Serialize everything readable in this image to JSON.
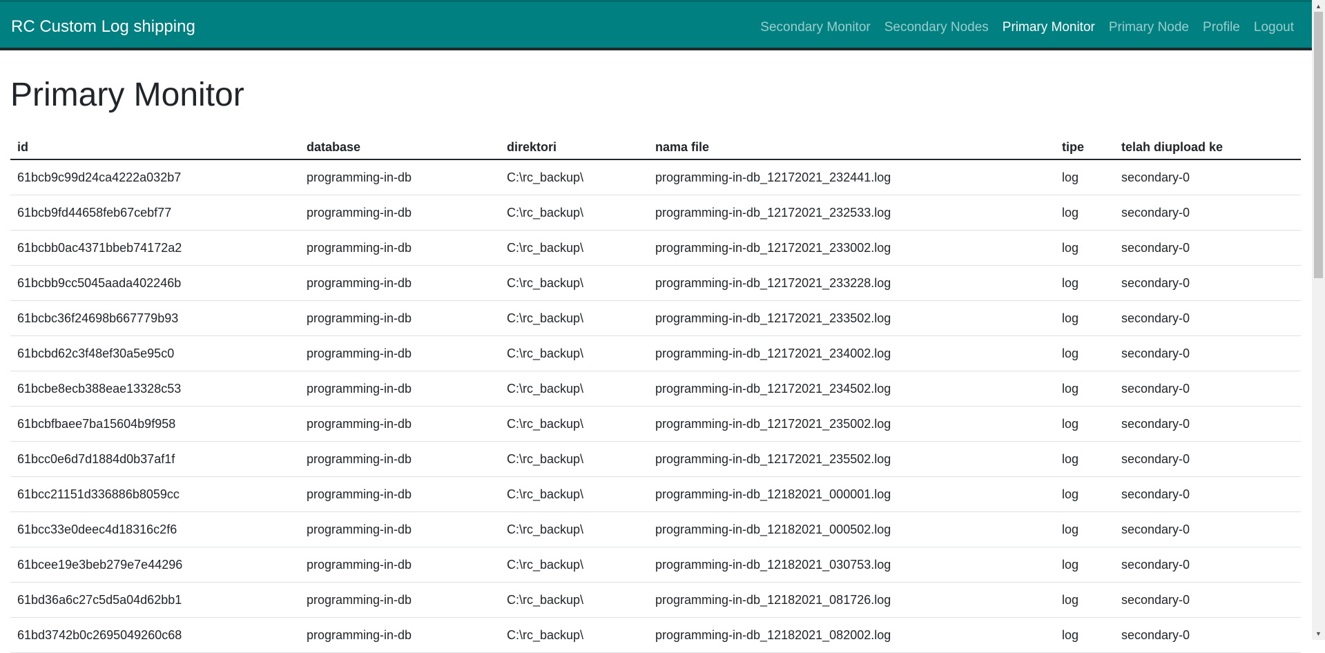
{
  "app": {
    "brand": "RC Custom Log shipping",
    "nav": [
      {
        "label": "Secondary Monitor",
        "active": false
      },
      {
        "label": "Secondary Nodes",
        "active": false
      },
      {
        "label": "Primary Monitor",
        "active": true
      },
      {
        "label": "Primary Node",
        "active": false
      },
      {
        "label": "Profile",
        "active": false
      },
      {
        "label": "Logout",
        "active": false
      }
    ]
  },
  "page": {
    "title": "Primary Monitor"
  },
  "table": {
    "headers": [
      "id",
      "database",
      "direktori",
      "nama file",
      "tipe",
      "telah diupload ke"
    ],
    "rows": [
      [
        "61bcb9c99d24ca4222a032b7",
        "programming-in-db",
        "C:\\rc_backup\\",
        "programming-in-db_12172021_232441.log",
        "log",
        "secondary-0"
      ],
      [
        "61bcb9fd44658feb67cebf77",
        "programming-in-db",
        "C:\\rc_backup\\",
        "programming-in-db_12172021_232533.log",
        "log",
        "secondary-0"
      ],
      [
        "61bcbb0ac4371bbeb74172a2",
        "programming-in-db",
        "C:\\rc_backup\\",
        "programming-in-db_12172021_233002.log",
        "log",
        "secondary-0"
      ],
      [
        "61bcbb9cc5045aada402246b",
        "programming-in-db",
        "C:\\rc_backup\\",
        "programming-in-db_12172021_233228.log",
        "log",
        "secondary-0"
      ],
      [
        "61bcbc36f24698b667779b93",
        "programming-in-db",
        "C:\\rc_backup\\",
        "programming-in-db_12172021_233502.log",
        "log",
        "secondary-0"
      ],
      [
        "61bcbd62c3f48ef30a5e95c0",
        "programming-in-db",
        "C:\\rc_backup\\",
        "programming-in-db_12172021_234002.log",
        "log",
        "secondary-0"
      ],
      [
        "61bcbe8ecb388eae13328c53",
        "programming-in-db",
        "C:\\rc_backup\\",
        "programming-in-db_12172021_234502.log",
        "log",
        "secondary-0"
      ],
      [
        "61bcbfbaee7ba15604b9f958",
        "programming-in-db",
        "C:\\rc_backup\\",
        "programming-in-db_12172021_235002.log",
        "log",
        "secondary-0"
      ],
      [
        "61bcc0e6d7d1884d0b37af1f",
        "programming-in-db",
        "C:\\rc_backup\\",
        "programming-in-db_12172021_235502.log",
        "log",
        "secondary-0"
      ],
      [
        "61bcc21151d336886b8059cc",
        "programming-in-db",
        "C:\\rc_backup\\",
        "programming-in-db_12182021_000001.log",
        "log",
        "secondary-0"
      ],
      [
        "61bcc33e0deec4d18316c2f6",
        "programming-in-db",
        "C:\\rc_backup\\",
        "programming-in-db_12182021_000502.log",
        "log",
        "secondary-0"
      ],
      [
        "61bcee19e3beb279e7e44296",
        "programming-in-db",
        "C:\\rc_backup\\",
        "programming-in-db_12182021_030753.log",
        "log",
        "secondary-0"
      ],
      [
        "61bd36a6c27c5d5a04d62bb1",
        "programming-in-db",
        "C:\\rc_backup\\",
        "programming-in-db_12182021_081726.log",
        "log",
        "secondary-0"
      ],
      [
        "61bd3742b0c2695049260c68",
        "programming-in-db",
        "C:\\rc_backup\\",
        "programming-in-db_12182021_082002.log",
        "log",
        "secondary-0"
      ]
    ]
  },
  "colors": {
    "navbar": "#008080",
    "navbar_border": "#1f2a2a"
  },
  "icons": {
    "scroll_up": "triangle-up-icon",
    "scroll_down": "triangle-down-icon"
  }
}
